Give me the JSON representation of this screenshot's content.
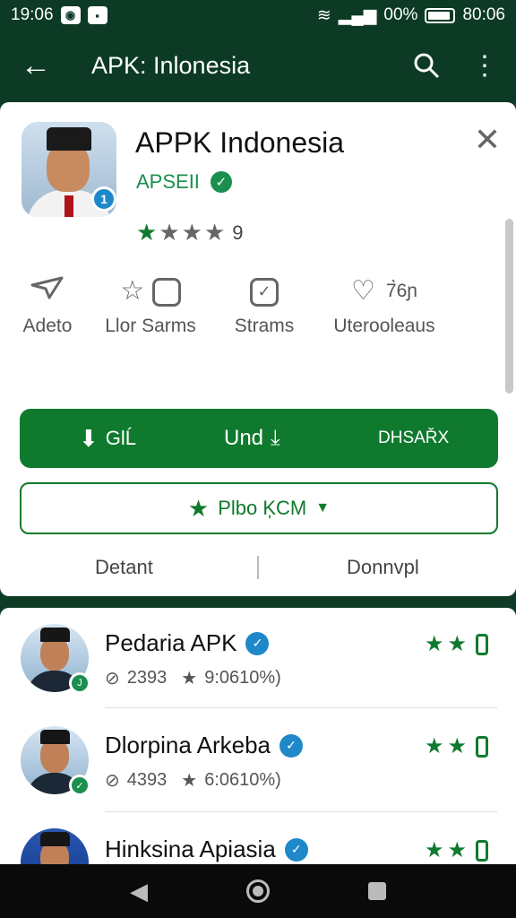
{
  "status_bar": {
    "time": "19:06",
    "battery_text": "00%",
    "time_right": "80:06"
  },
  "app_bar": {
    "title": "APK: Inlonesia"
  },
  "app": {
    "name": "APPK Indonesia",
    "developer": "APSEII",
    "icon_badge": "1",
    "rating_count": "9",
    "stars_filled": 1,
    "stars_total": 4
  },
  "actions": [
    {
      "label": "Adeto",
      "icon": "send-icon"
    },
    {
      "label": "Llor Sarms",
      "icon": "star-outline-icon"
    },
    {
      "label": "Strams",
      "icon": "image-check-icon"
    },
    {
      "label": "Uterooleaus",
      "icon": "heart-icon",
      "count": "7̀6ɲ"
    }
  ],
  "install_button": {
    "left": "GlĹ",
    "middle": "Und",
    "right": "DHSAŘX"
  },
  "wishlist_button": {
    "label": "Plbo ĶCM"
  },
  "tabs": {
    "left": "Detant",
    "right": "Donnvpl"
  },
  "list": [
    {
      "title": "Pedaria APK",
      "count": "2393",
      "rating": "9:0610%)",
      "badge": "J"
    },
    {
      "title": "Dlorpina Arkeba",
      "count": "4393",
      "rating": "6:0610%)",
      "badge": "✓"
    },
    {
      "title": "Hinksina Apiasia",
      "count": "",
      "rating": "",
      "badge": ""
    }
  ],
  "colors": {
    "brand_dark": "#0c3a25",
    "accent_green": "#0f7a2e",
    "verified_blue": "#1e88c9"
  }
}
